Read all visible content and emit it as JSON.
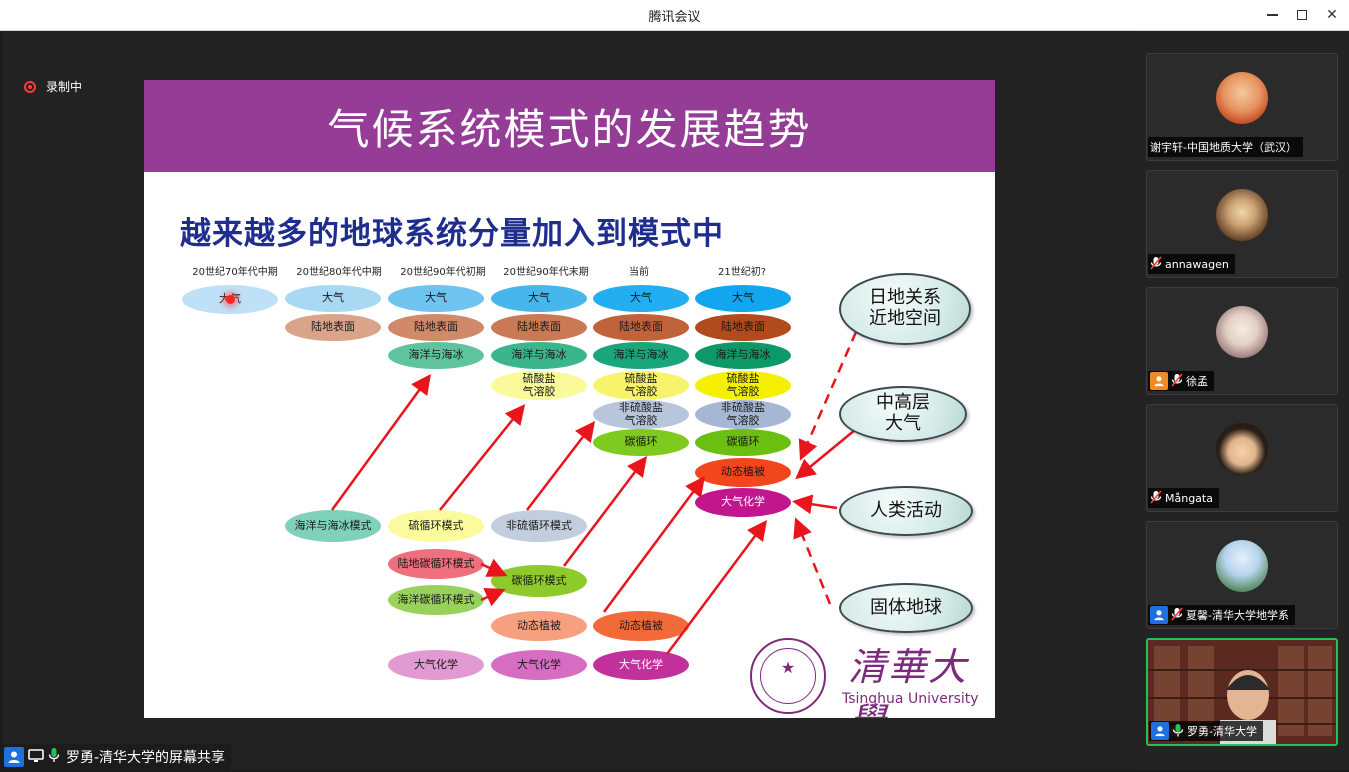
{
  "window": {
    "title": "腾讯会议",
    "minimize_icon": "minimize-icon",
    "maximize_icon": "maximize-icon",
    "close_icon": "close-icon"
  },
  "recording": {
    "label": "录制中",
    "color": "#ff3b3b"
  },
  "slide": {
    "title": "气候系统模式的发展趋势",
    "subtitle": "越来越多的地球系统分量加入到模式中",
    "header_color": "#953c97",
    "columns": [
      "20世纪70年代中期",
      "20世纪80年代中期",
      "20世纪90年代初期",
      "20世纪90年代末期",
      "当前",
      "21世纪初?"
    ],
    "col1": [
      "大气"
    ],
    "col2": [
      "大气",
      "陆地表面"
    ],
    "col3": [
      "大气",
      "陆地表面",
      "海洋与海冰"
    ],
    "col4": [
      "大气",
      "陆地表面",
      "海洋与海冰",
      "硫酸盐\n气溶胶"
    ],
    "col5": [
      "大气",
      "陆地表面",
      "海洋与海冰",
      "硫酸盐\n气溶胶",
      "非硫酸盐\n气溶胶",
      "碳循环"
    ],
    "col6": [
      "大气",
      "陆地表面",
      "海洋与海冰",
      "硫酸盐\n气溶胶",
      "非硫酸盐\n气溶胶",
      "碳循环",
      "动态植被",
      "大气化学"
    ],
    "models": {
      "ocean_ice": "海洋与海冰模式",
      "sulfur": "硫循环模式",
      "nonsulfur": "非硫循环模式",
      "land_carbon": "陆地碳循环模式",
      "ocean_carbon": "海洋碳循环模式",
      "carbon": "碳循环模式",
      "dynveg1": "动态植被",
      "dynveg2": "动态植被",
      "chem1": "大气化学",
      "chem2": "大气化学",
      "chem3": "大气化学"
    },
    "bubbles": [
      "日地关系\n近地空间",
      "中高层\n大气",
      "人类活动",
      "固体地球"
    ],
    "brand_cn": "清華大學",
    "brand_en": "Tsinghua University",
    "brand_color": "#7c2b7c"
  },
  "participants": [
    {
      "name": "谢宇轩-中国地质大学（武汉）",
      "muted": false,
      "avatar_icon": "avatar-photo-icon"
    },
    {
      "name": "annawagen",
      "muted": true,
      "avatar_icon": "avatar-photo-icon"
    },
    {
      "name": "徐孟",
      "muted": true,
      "avatar_icon": "avatar-photo-icon"
    },
    {
      "name": "Mångata",
      "muted": true,
      "avatar_icon": "avatar-photo-icon"
    },
    {
      "name": "夏馨-清华大学地学系",
      "muted": true,
      "avatar_icon": "avatar-photo-icon"
    },
    {
      "name": "罗勇-清华大学",
      "muted": false,
      "avatar_icon": "video-feed"
    }
  ],
  "share_bar": {
    "label": "罗勇-清华大学的屏幕共享"
  }
}
